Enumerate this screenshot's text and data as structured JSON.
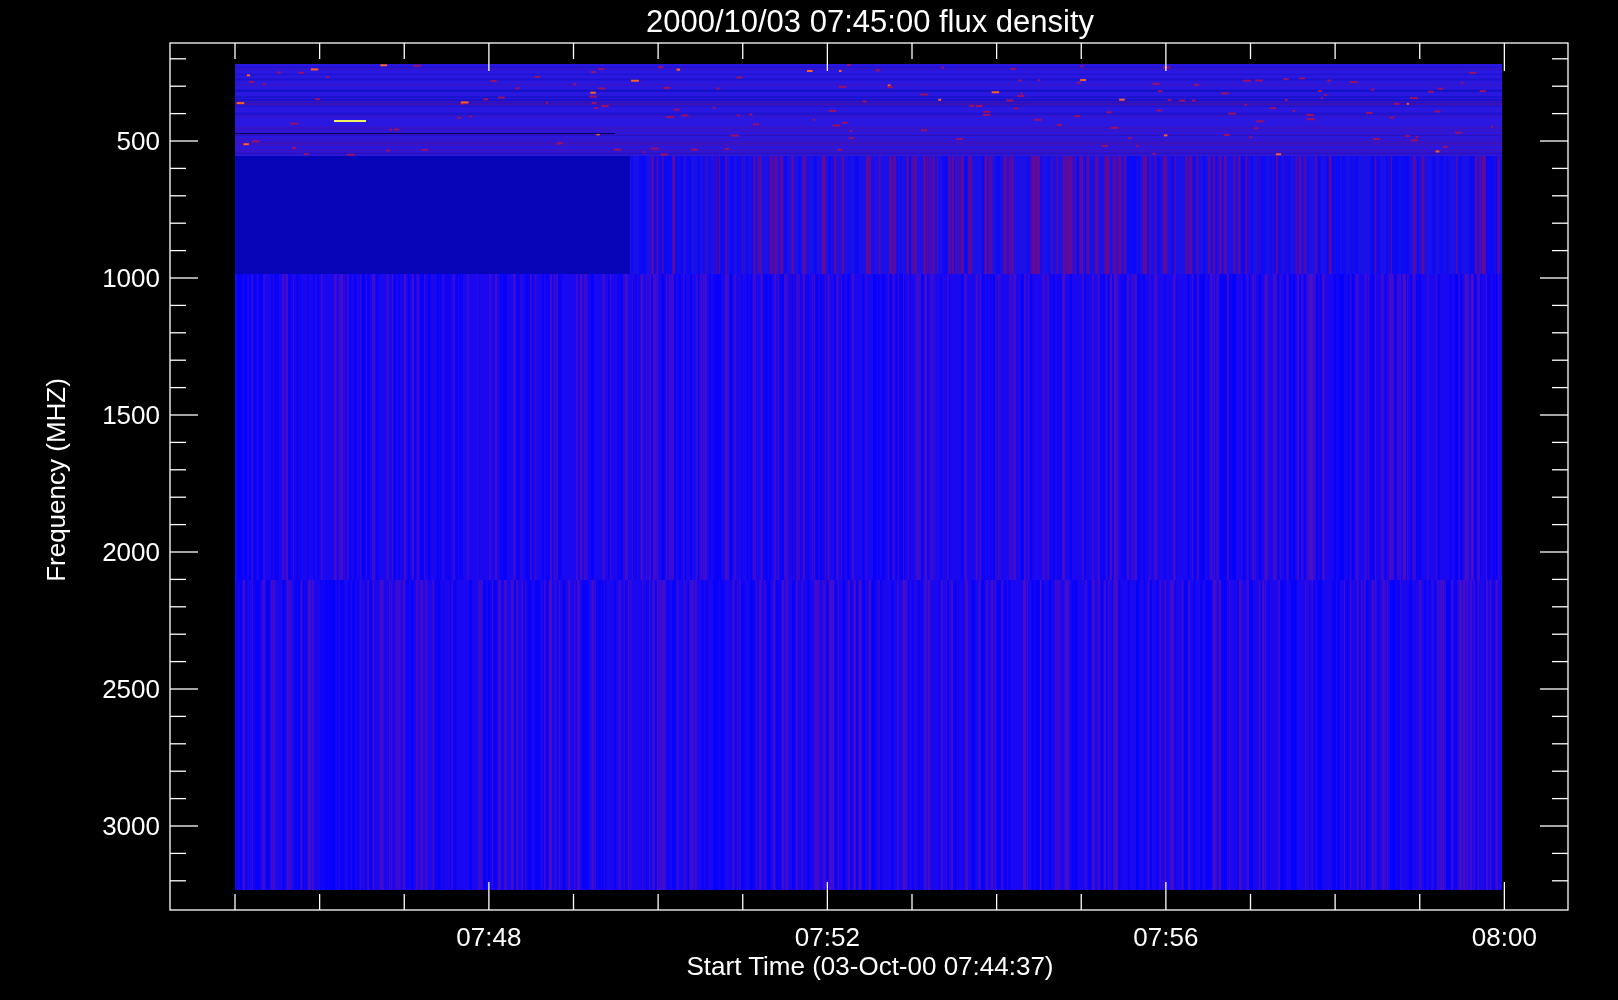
{
  "plot": {
    "title": "2000/10/03 07:45:00 flux density",
    "y_axis": {
      "title": "Frequency (MHZ)",
      "tick_labels": [
        "500",
        "1000",
        "1500",
        "2000",
        "2500",
        "3000"
      ]
    },
    "x_axis": {
      "title": "Start Time (03-Oct-00 07:44:37)",
      "tick_labels": [
        "07:48",
        "07:52",
        "07:56",
        "08:00"
      ]
    }
  }
}
